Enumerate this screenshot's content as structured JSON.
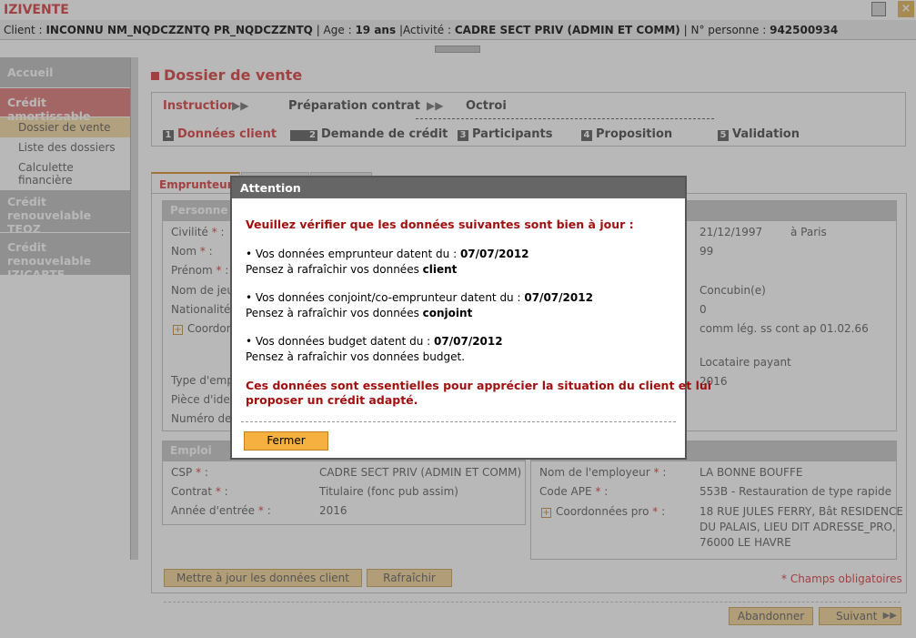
{
  "app": {
    "name": "IZIVENTE"
  },
  "infobar": {
    "client_label": "Client :",
    "client": "INCONNU NM_NQDCZZNTQ PR_NQDCZZNTQ",
    "age_label": "| Age :",
    "age": "19 ans",
    "activite_label": "|Activité :",
    "activite": "CADRE SECT PRIV (ADMIN ET COMM)",
    "personne_label": "| N° personne :",
    "personne": "942500934"
  },
  "sidebar": {
    "items": [
      {
        "label": "Accueil"
      },
      {
        "label": "Crédit amortissable"
      },
      {
        "label": "Dossier de vente"
      },
      {
        "label": "Liste des dossiers"
      },
      {
        "label": "Calculette financière"
      },
      {
        "label": "Crédit renouvelable TEOZ"
      },
      {
        "label": "Crédit renouvelable IZICARTE"
      }
    ]
  },
  "page": {
    "title": "Dossier de vente"
  },
  "steps": {
    "phases": [
      "Instruction",
      "Préparation contrat",
      "Octroi"
    ],
    "substeps": [
      {
        "num": "1",
        "label": "Données client"
      },
      {
        "num": "2",
        "label": "Demande de crédit"
      },
      {
        "num": "3",
        "label": "Participants"
      },
      {
        "num": "4",
        "label": "Proposition"
      },
      {
        "num": "5",
        "label": "Validation"
      }
    ]
  },
  "tabs": {
    "emprunteur": "Emprunteur"
  },
  "personne": {
    "title": "Personne",
    "labels": [
      "Civilité",
      "Nom",
      "Prénom",
      "Nom de jeu",
      "Nationalité",
      "Coordon",
      "Type d'emp",
      "Pièce d'iden",
      "Numéro de"
    ],
    "right_values": [
      "21/12/1997",
      "à Paris",
      "99",
      "Concubin(e)",
      "0",
      "comm lég. ss cont ap 01.02.66",
      "Locataire payant",
      "2016"
    ]
  },
  "emploi": {
    "title": "Emploi",
    "csp_label": "CSP",
    "csp": "CADRE SECT PRIV (ADMIN ET COMM)",
    "contrat_label": "Contrat",
    "contrat": "Titulaire (fonc pub assim)",
    "annee_label": "Année d'entrée",
    "annee": "2016",
    "employeur_label": "Nom de l'employeur",
    "employeur": "LA BONNE BOUFFE",
    "ape_label": "Code APE",
    "ape": "553B - Restauration de type rapide",
    "coord_label": "Coordonnées pro",
    "coord_l1": "18 RUE JULES FERRY, Bât RESIDENCE",
    "coord_l2": "DU PALAIS, LIEU DIT ADRESSE_PRO,",
    "coord_l3": "76000 LE HAVRE"
  },
  "buttons": {
    "maj": "Mettre à jour les données client",
    "rafraichir": "Rafraîchir",
    "champs": "* Champs obligatoires",
    "abandonner": "Abandonner",
    "suivant": "Suivant"
  },
  "modal": {
    "title": "Attention",
    "intro": "Veuillez vérifier que les données suivantes sont bien à jour :",
    "b1_text": "• Vos données emprunteur datent du :",
    "b1_date": "07/07/2012",
    "b1_hint": "Pensez à rafraîchir vos données",
    "b1_hint_b": "client",
    "b2_text": "• Vos données conjoint/co-emprunteur datent du :",
    "b2_date": "07/07/2012",
    "b2_hint": "Pensez à rafraîchir vos données",
    "b2_hint_b": "conjoint",
    "b3_text": "• Vos données budget datent du :",
    "b3_date": "07/07/2012",
    "b3_hint": "Pensez à rafraîchir vos données budget.",
    "warning_l1": "Ces données sont essentielles pour apprécier la situation du client et lui",
    "warning_l2": "proposer un crédit adapté.",
    "button": "Fermer"
  }
}
